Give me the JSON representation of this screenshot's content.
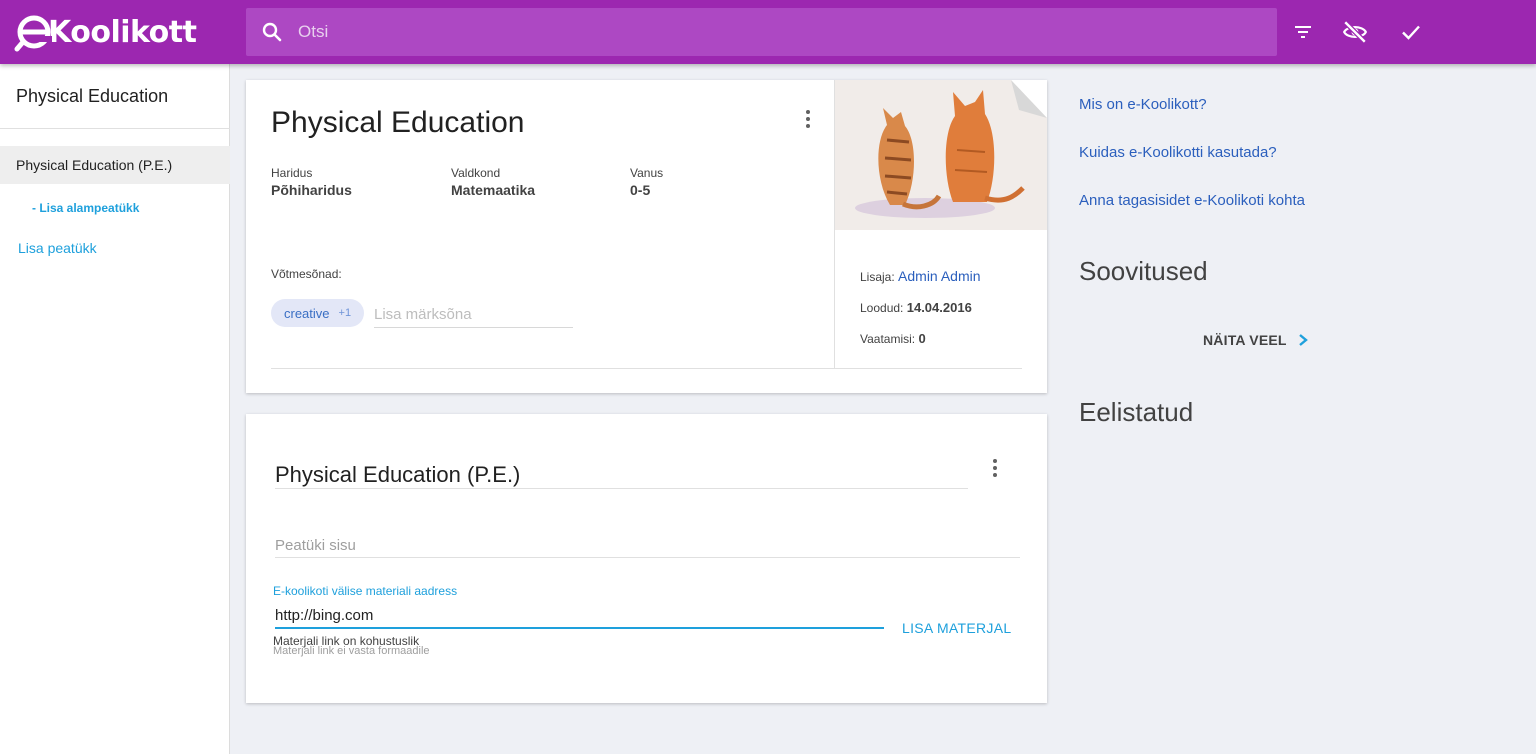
{
  "header": {
    "logo_text": "Koolikott",
    "search_placeholder": "Otsi",
    "icons": [
      "search-icon",
      "filter-icon",
      "visibility-off-icon",
      "check-icon"
    ],
    "colors": {
      "bar": "#9c27b0",
      "search": "#ad48c3"
    }
  },
  "sidebar": {
    "title": "Physical Education",
    "active_item": "Physical Education (P.E.)",
    "sub_item": "- Lisa alampeatükk",
    "add_chapter": "Lisa peatükk"
  },
  "material": {
    "title": "Physical Education",
    "meta": [
      {
        "label": "Haridus",
        "value": "Põhiharidus"
      },
      {
        "label": "Valdkond",
        "value": "Matemaatika"
      },
      {
        "label": "Vanus",
        "value": "0-5"
      }
    ],
    "keywords_label": "Võtmesõnad:",
    "chip_text": "creative",
    "chip_count": "+1",
    "keyword_placeholder": "Lisa märksõna",
    "added_by_label": "Lisaja:",
    "added_by": "Admin Admin",
    "created_label": "Loodud:",
    "created": "14.04.2016",
    "views_label": "Vaatamisi:",
    "views": "0"
  },
  "chapter": {
    "title": "Physical Education (P.E.)",
    "content_placeholder": "Peatüki sisu",
    "url_label": "E-koolikoti välise materiali aadress",
    "url_value": "http://bing.com",
    "hint_required": "Materjali link on kohustuslik",
    "hint_format": "Materjali link ei vasta formaadile",
    "add_material": "LISA MATERJAL"
  },
  "right": {
    "links": [
      "Mis on e-Koolikott?",
      "Kuidas e-Koolikotti kasutada?",
      "Anna tagasisidet e-Koolikoti kohta"
    ],
    "recommendations": "Soovitused",
    "show_more": "NÄITA VEEL",
    "featured": "Eelistatud"
  }
}
